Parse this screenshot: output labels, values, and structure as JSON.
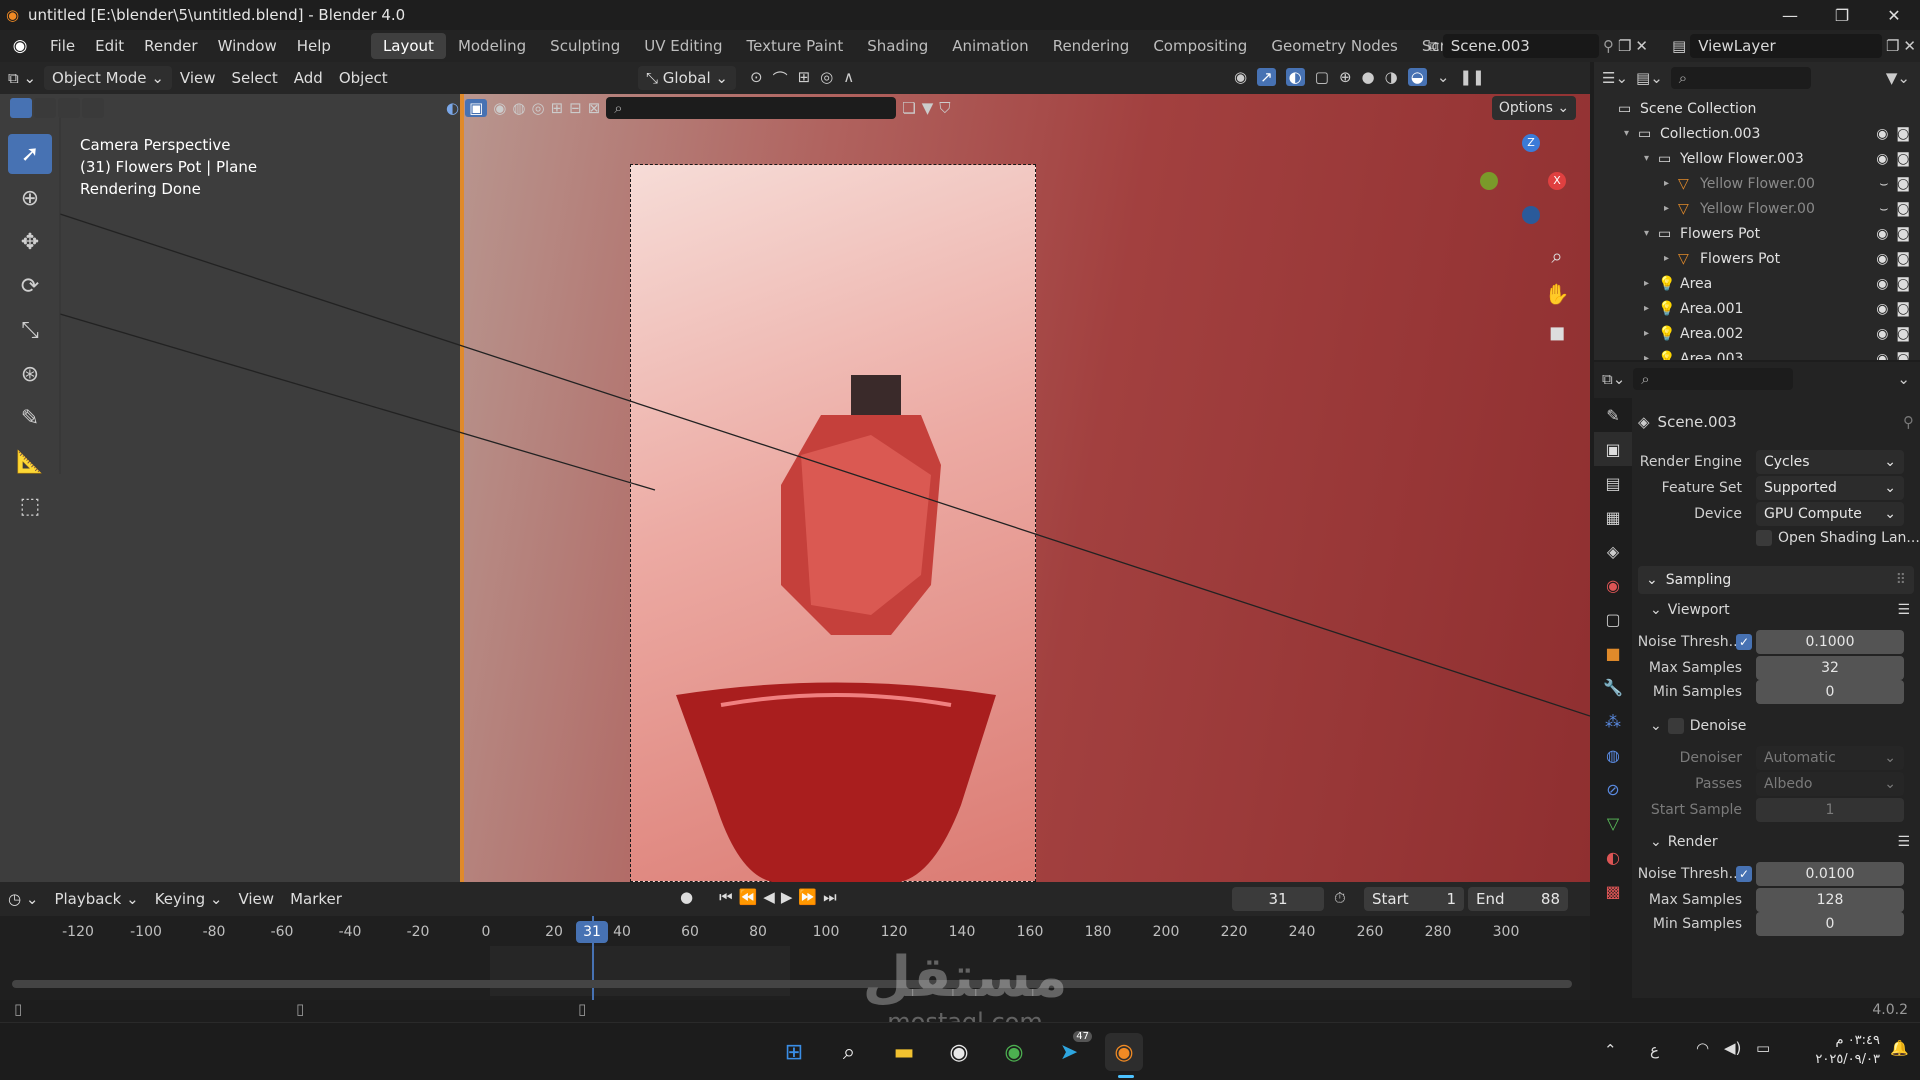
{
  "window": {
    "title": "untitled [E:\\blender\\5\\untitled.blend] - Blender 4.0",
    "controls": [
      "—",
      "❐",
      "✕"
    ]
  },
  "menubar": {
    "items": [
      "File",
      "Edit",
      "Render",
      "Window",
      "Help"
    ],
    "workspaces": [
      "Layout",
      "Modeling",
      "Sculpting",
      "UV Editing",
      "Texture Paint",
      "Shading",
      "Animation",
      "Rendering",
      "Compositing",
      "Geometry Nodes",
      "Scripting"
    ],
    "active_workspace": "Layout",
    "scene": "Scene.003",
    "view_layer": "ViewLayer"
  },
  "viewport_header": {
    "mode": "Object Mode",
    "menus": [
      "View",
      "Select",
      "Add",
      "Object"
    ],
    "orientation": "Global",
    "options": "Options"
  },
  "viewport_info": {
    "line1": "Camera Perspective",
    "line2": "(31) Flowers Pot | Plane",
    "line3": "Rendering Done"
  },
  "gizmo": {
    "z": "Z",
    "x": "X"
  },
  "timeline": {
    "menus": [
      "Playback",
      "Keying",
      "View",
      "Marker"
    ],
    "current_frame": "31",
    "start_label": "Start",
    "start": "1",
    "end_label": "End",
    "end": "88",
    "ticks": [
      "-120",
      "-100",
      "-80",
      "-60",
      "-40",
      "-20",
      "0",
      "20",
      "40",
      "60",
      "80",
      "100",
      "120",
      "140",
      "160",
      "180",
      "200",
      "220",
      "240",
      "260",
      "280",
      "300"
    ]
  },
  "outliner": {
    "rows": [
      {
        "label": "Scene Collection",
        "indent": 0,
        "dim": false,
        "icon": "scene-collection-icon"
      },
      {
        "label": "Collection.003",
        "indent": 1,
        "dim": false,
        "icon": "collection-icon"
      },
      {
        "label": "Yellow Flower.003",
        "indent": 2,
        "dim": false,
        "icon": "collection-icon"
      },
      {
        "label": "Yellow Flower.00",
        "indent": 3,
        "dim": true,
        "icon": "mesh-icon"
      },
      {
        "label": "Yellow Flower.00",
        "indent": 3,
        "dim": true,
        "icon": "mesh-icon"
      },
      {
        "label": "Flowers Pot",
        "indent": 2,
        "dim": false,
        "icon": "collection-icon"
      },
      {
        "label": "Flowers Pot",
        "indent": 3,
        "dim": false,
        "icon": "mesh-icon"
      },
      {
        "label": "Area",
        "indent": 2,
        "dim": false,
        "icon": "light-icon"
      },
      {
        "label": "Area.001",
        "indent": 2,
        "dim": false,
        "icon": "light-icon"
      },
      {
        "label": "Area.002",
        "indent": 2,
        "dim": false,
        "icon": "light-icon"
      },
      {
        "label": "Area.003",
        "indent": 2,
        "dim": false,
        "icon": "light-icon"
      }
    ]
  },
  "properties": {
    "scene": "Scene.003",
    "render_engine_label": "Render Engine",
    "render_engine": "Cycles",
    "feature_set_label": "Feature Set",
    "feature_set": "Supported",
    "device_label": "Device",
    "device": "GPU Compute",
    "osl_label": "Open Shading Lan...",
    "sampling": "Sampling",
    "viewport": "Viewport",
    "vp_noise_label": "Noise Thresh...",
    "vp_noise": "0.1000",
    "vp_max_label": "Max Samples",
    "vp_max": "32",
    "vp_min_label": "Min Samples",
    "vp_min": "0",
    "denoise": "Denoise",
    "denoiser_label": "Denoiser",
    "denoiser": "Automatic",
    "passes_label": "Passes",
    "passes": "Albedo",
    "start_sample_label": "Start Sample",
    "start_sample": "1",
    "render": "Render",
    "r_noise_label": "Noise Thresh...",
    "r_noise": "0.0100",
    "r_max_label": "Max Samples",
    "r_max": "128",
    "r_min_label": "Min Samples",
    "r_min": "0"
  },
  "status": {
    "version": "4.0.2"
  },
  "taskbar": {
    "clock_time": "٠٣:٤٩ م",
    "clock_date": "٢٠٢٥/٠٩/٠٣",
    "lang": "ع",
    "telegram_badge": "47"
  },
  "watermark": {
    "text": "مستقل",
    "url": "mostaql.com"
  }
}
